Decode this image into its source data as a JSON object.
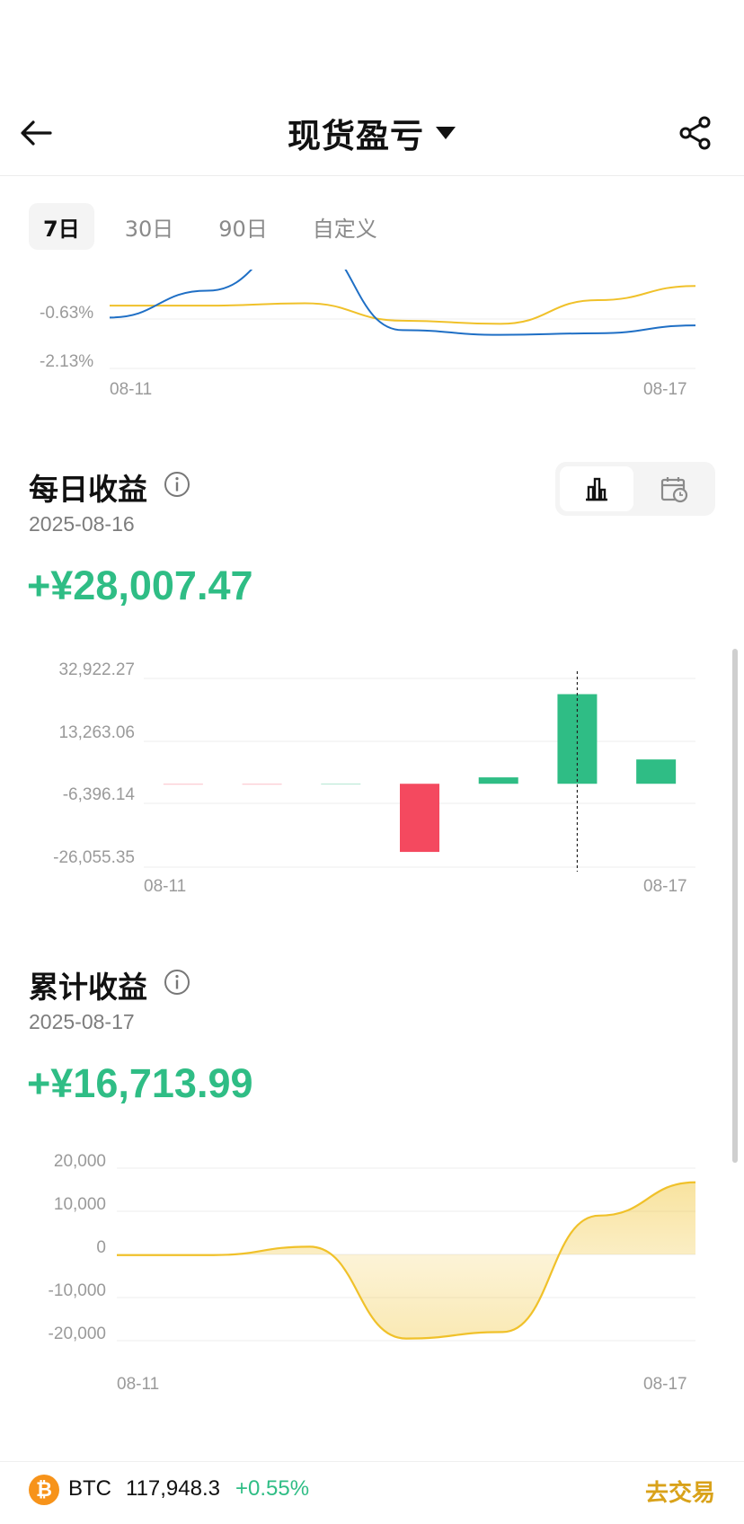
{
  "header": {
    "title": "现货盈亏",
    "back_icon": "arrow-left-icon",
    "dropdown_icon": "caret-down-icon",
    "share_icon": "share-icon"
  },
  "tabs": [
    {
      "label": "7日",
      "active": true
    },
    {
      "label": "30日",
      "active": false
    },
    {
      "label": "90日",
      "active": false
    },
    {
      "label": "自定义",
      "active": false
    }
  ],
  "colors": {
    "positive": "#2fbd85",
    "negative": "#f4495f",
    "accent_yellow": "#f0c12a",
    "line_blue": "#1f6fc5"
  },
  "daily": {
    "title": "每日收益",
    "date": "2025-08-16",
    "value": "+¥28,007.47",
    "view_options": [
      "bar-chart-icon",
      "calendar-clock-icon"
    ]
  },
  "cumulative": {
    "title": "累计收益",
    "date": "2025-08-17",
    "value": "+¥16,713.99"
  },
  "chart_data": [
    {
      "type": "line",
      "yticks": [
        "-0.63%",
        "-2.13%"
      ],
      "xticks": [
        "08-11",
        "08-17"
      ],
      "series": [
        {
          "color": "#f0c12a",
          "values": [
            0.25,
            0.25,
            0.4,
            -0.7,
            -0.9,
            0.6,
            1.5
          ]
        },
        {
          "color": "#1f6fc5",
          "values": [
            -0.5,
            1.2,
            4.5,
            -1.3,
            -1.6,
            -1.5,
            -1.0
          ]
        }
      ],
      "partial": true
    },
    {
      "type": "bar",
      "categories": [
        "08-11",
        "08-12",
        "08-13",
        "08-14",
        "08-15",
        "08-16",
        "08-17"
      ],
      "xticks": [
        "08-11",
        "08-17"
      ],
      "yticks": [
        "32,922.27",
        "13,263.06",
        "-6,396.14",
        "-26,055.35"
      ],
      "values": [
        -150,
        -100,
        60,
        -21300,
        2000,
        28007.47,
        7600
      ],
      "ylim": [
        -26055.35,
        32922.27
      ],
      "highlight": "08-16"
    },
    {
      "type": "area",
      "xticks": [
        "08-11",
        "08-17"
      ],
      "yticks": [
        "20,000",
        "10,000",
        "0",
        "-10,000",
        "-20,000"
      ],
      "x": [
        "08-11",
        "08-12",
        "08-13",
        "08-14",
        "08-15",
        "08-16",
        "08-17"
      ],
      "values": [
        -150,
        -150,
        1800,
        -19500,
        -18000,
        9000,
        16713.99
      ],
      "ylim": [
        -20000,
        20000
      ]
    }
  ],
  "ticker": {
    "symbol": "BTC",
    "coin_icon": "bitcoin-icon",
    "price": "117,948.3",
    "change": "+0.55%",
    "trade_label": "去交易"
  }
}
